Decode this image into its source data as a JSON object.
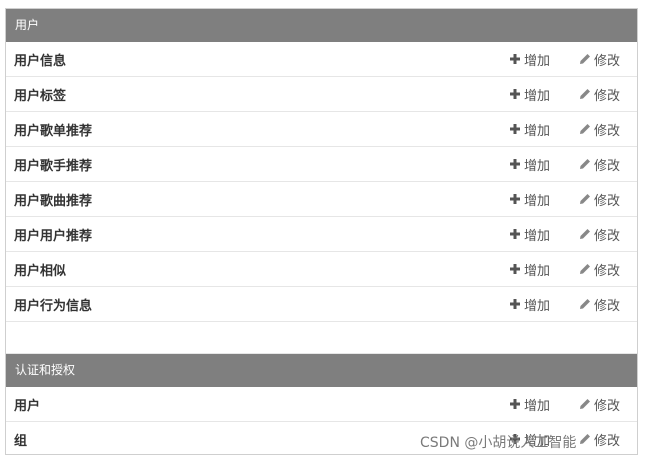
{
  "modules": [
    {
      "title": "用户",
      "rows": [
        {
          "label": "用户信息",
          "add": "增加",
          "change": "修改"
        },
        {
          "label": "用户标签",
          "add": "增加",
          "change": "修改"
        },
        {
          "label": "用户歌单推荐",
          "add": "增加",
          "change": "修改"
        },
        {
          "label": "用户歌手推荐",
          "add": "增加",
          "change": "修改"
        },
        {
          "label": "用户歌曲推荐",
          "add": "增加",
          "change": "修改"
        },
        {
          "label": "用户用户推荐",
          "add": "增加",
          "change": "修改"
        },
        {
          "label": "用户相似",
          "add": "增加",
          "change": "修改"
        },
        {
          "label": "用户行为信息",
          "add": "增加",
          "change": "修改"
        }
      ]
    },
    {
      "title": "认证和授权",
      "rows": [
        {
          "label": "用户",
          "add": "增加",
          "change": "修改"
        },
        {
          "label": "组",
          "add": "增加",
          "change": "修改"
        }
      ]
    }
  ],
  "watermark": "CSDN @小胡说人工智能",
  "colors": {
    "header_bg": "#7f7f7f",
    "header_text": "#ffffff",
    "row_border": "#e6e6e6"
  },
  "icons": {
    "add": "plus-icon",
    "change": "pencil-icon"
  }
}
